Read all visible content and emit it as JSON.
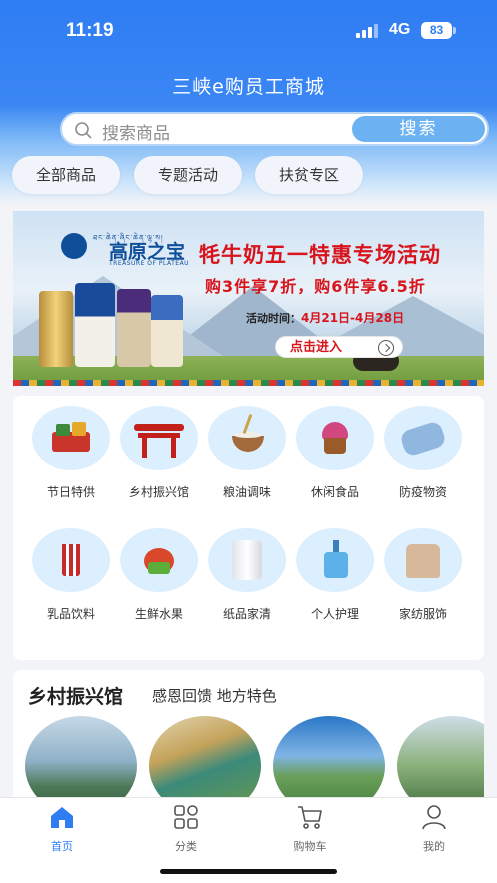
{
  "status_bar": {
    "time": "11:19",
    "network": "4G",
    "battery": "83"
  },
  "app": {
    "title": "三峡e购员工商城"
  },
  "search": {
    "placeholder": "搜索商品",
    "button_label": "搜索"
  },
  "chips": [
    {
      "label": "全部商品"
    },
    {
      "label": "专题活动"
    },
    {
      "label": "扶贫专区"
    }
  ],
  "banner": {
    "brand": "高原之宝",
    "brand_sub": "ཐང་ཆེན་ཞིང་ཆེན་ལྷ་ས།",
    "brand_en": "TREASURE OF PLATEAU",
    "headline": "牦牛奶五一特惠专场活动",
    "offer": "购3件享7折，购6件享6.5折",
    "date_label": "活动时间：",
    "date_value": "4月21日-4月28日",
    "cta": "点击进入"
  },
  "categories": [
    {
      "label": "节日特供",
      "icon": "gift-box-icon"
    },
    {
      "label": "乡村振兴馆",
      "icon": "pavilion-gate-icon"
    },
    {
      "label": "粮油调味",
      "icon": "grain-bowl-icon"
    },
    {
      "label": "休闲食品",
      "icon": "cupcake-icon"
    },
    {
      "label": "防疫物资",
      "icon": "face-mask-icon"
    },
    {
      "label": "乳品饮料",
      "icon": "drink-cup-icon"
    },
    {
      "label": "生鲜水果",
      "icon": "fruit-teapot-icon"
    },
    {
      "label": "纸品家清",
      "icon": "paper-roll-icon"
    },
    {
      "label": "个人护理",
      "icon": "pump-bottle-icon"
    },
    {
      "label": "家纺服饰",
      "icon": "sweater-icon"
    }
  ],
  "village": {
    "title": "乡村振兴馆",
    "subtitle": "感恩回馈 地方特色"
  },
  "tabs": [
    {
      "label": "首页",
      "icon": "home-icon",
      "active": true
    },
    {
      "label": "分类",
      "icon": "category-grid-icon",
      "active": false
    },
    {
      "label": "购物车",
      "icon": "cart-icon",
      "active": false
    },
    {
      "label": "我的",
      "icon": "user-icon",
      "active": false
    }
  ],
  "colors": {
    "primary": "#2f7df3",
    "banner_red": "#d8141c",
    "icon_bg": "#dcefff"
  }
}
